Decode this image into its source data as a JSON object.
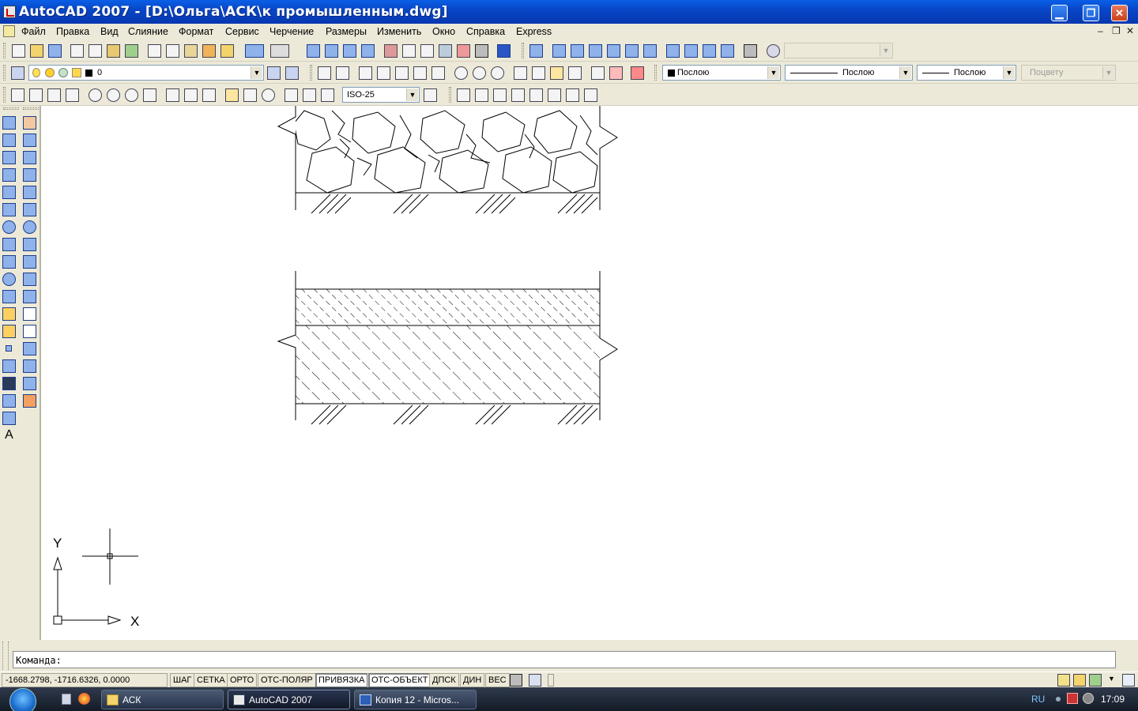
{
  "window": {
    "title": "AutoCAD 2007 - [D:\\Ольга\\АСК\\к промышленным.dwg]",
    "minimize": "▁",
    "restore": "❐",
    "close": "✕"
  },
  "menu": {
    "items": [
      "Файл",
      "Правка",
      "Вид",
      "Слияние",
      "Формат",
      "Сервис",
      "Черчение",
      "Размеры",
      "Изменить",
      "Окно",
      "Справка",
      "Express"
    ],
    "doc_minimize": "–",
    "doc_restore": "❐",
    "doc_close": "✕"
  },
  "properties": {
    "layer": "0",
    "color": "Послою",
    "linetype": "Послою",
    "lineweight": "Послою",
    "plotstyle": "Поцвету",
    "dimstyle": "ISO-25"
  },
  "ucs": {
    "y_label": "Y",
    "x_label": "X"
  },
  "command": {
    "prompt": "Команда:"
  },
  "status": {
    "coords": "-1668.2798, -1716.6326, 0.0000",
    "buttons": [
      {
        "label": "ШАГ",
        "on": false
      },
      {
        "label": "СЕТКА",
        "on": false
      },
      {
        "label": "ОРТО",
        "on": false
      },
      {
        "label": "ОТС-ПОЛЯР",
        "on": false
      },
      {
        "label": "ПРИВЯЗКА",
        "on": true
      },
      {
        "label": "ОТС-ОБЪЕКТ",
        "on": true
      },
      {
        "label": "ДПСК",
        "on": false
      },
      {
        "label": "ДИН",
        "on": false
      },
      {
        "label": "ВЕС",
        "on": false
      }
    ]
  },
  "taskbar": {
    "tasks": [
      {
        "label": "АСК",
        "active": false
      },
      {
        "label": "AutoCAD 2007",
        "active": true
      },
      {
        "label": "Копия 12 - Micros...",
        "active": false
      }
    ],
    "language": "RU",
    "clock": "17:09"
  }
}
